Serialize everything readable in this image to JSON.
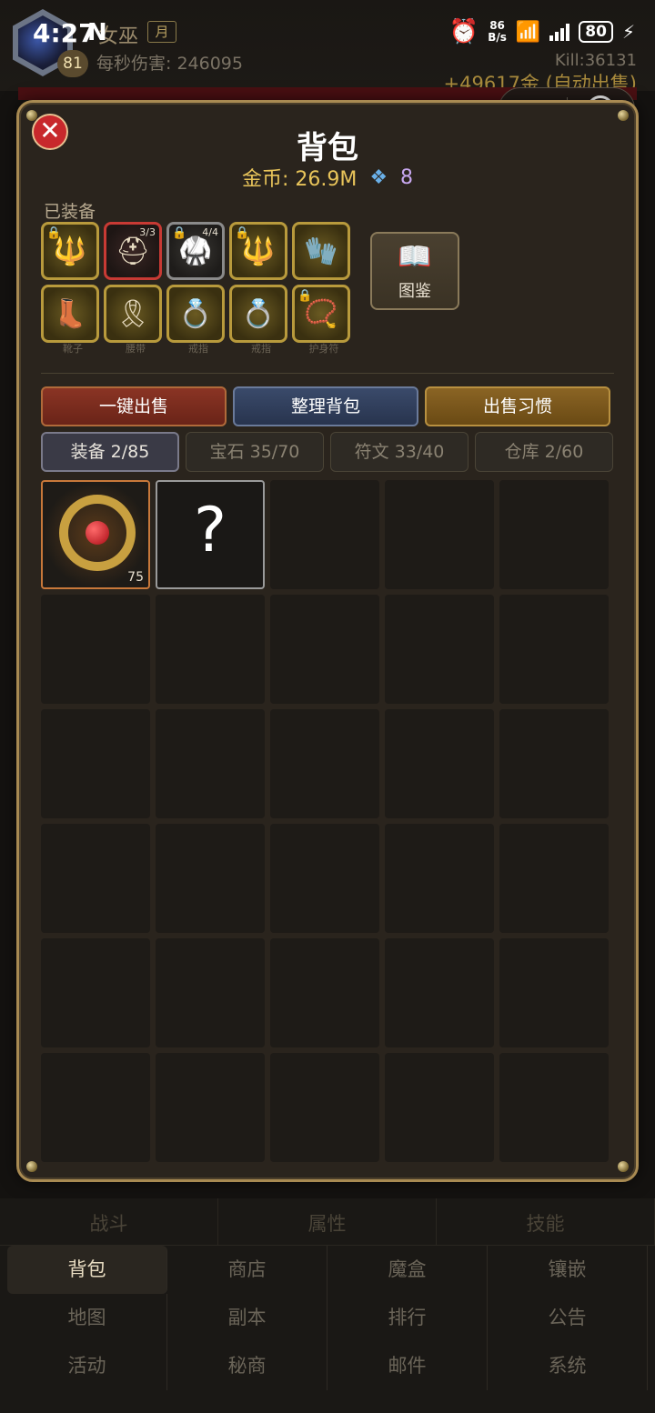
{
  "status_bar": {
    "time": "4:27",
    "nfc": "N",
    "net_speed_top": "86",
    "net_speed_bottom": "B/s",
    "battery": "80"
  },
  "hud": {
    "char_name": "女巫",
    "month_badge": "月",
    "level": "81",
    "dps": "每秒伤害: 246095",
    "kill": "Kill:36131",
    "gold_gain": "+49617金 (自动出售)"
  },
  "panel": {
    "title": "背包",
    "gold": "金币: 26.9M",
    "gems": "8",
    "equipped_label": "已装备",
    "codex_label": "图鉴",
    "equipped_slots": [
      {
        "icon": "staff-icon",
        "glyph": "🔱",
        "locked": true,
        "count": "",
        "label": ""
      },
      {
        "icon": "helmet-icon",
        "glyph": "⛑",
        "locked": false,
        "count": "3/3",
        "label": ""
      },
      {
        "icon": "armor-icon",
        "glyph": "🥋",
        "locked": true,
        "count": "4/4",
        "label": ""
      },
      {
        "icon": "staff-icon",
        "glyph": "🔱",
        "locked": true,
        "count": "",
        "label": ""
      },
      {
        "icon": "gloves-icon",
        "glyph": "🧤",
        "locked": false,
        "count": "",
        "label": ""
      },
      {
        "icon": "boots-icon",
        "glyph": "👢",
        "locked": false,
        "count": "",
        "label": "靴子"
      },
      {
        "icon": "belt-icon",
        "glyph": "🎗",
        "locked": false,
        "count": "",
        "label": "腰带"
      },
      {
        "icon": "ring-icon",
        "glyph": "💍",
        "locked": false,
        "count": "",
        "label": "戒指"
      },
      {
        "icon": "ring-icon",
        "glyph": "💍",
        "locked": false,
        "count": "",
        "label": "戒指"
      },
      {
        "icon": "amulet-icon",
        "glyph": "📿",
        "locked": true,
        "count": "",
        "label": "护身符"
      }
    ],
    "actions": [
      "一键出售",
      "整理背包",
      "出售习惯"
    ],
    "tabs": [
      "装备 2/85",
      "宝石 35/70",
      "符文 33/40",
      "仓库 2/60"
    ],
    "inventory": {
      "item_level": "75",
      "unknown_mark": "?"
    }
  },
  "bottom_nav": {
    "top_tabs": [
      "战斗",
      "属性",
      "技能"
    ],
    "items": [
      "背包",
      "商店",
      "魔盒",
      "镶嵌",
      "地图",
      "副本",
      "排行",
      "公告",
      "活动",
      "秘商",
      "邮件",
      "系统"
    ]
  }
}
